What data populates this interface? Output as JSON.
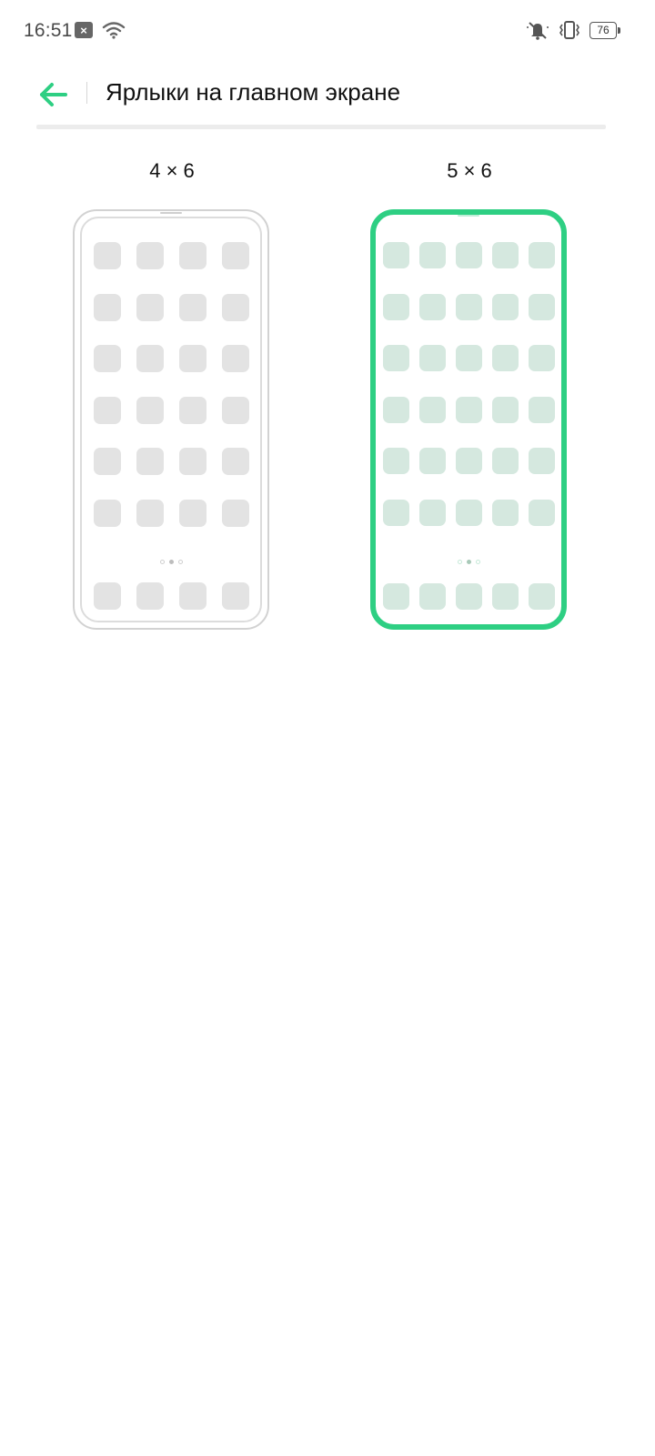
{
  "status_bar": {
    "time": "16:51",
    "notification_icon": "close-box-icon",
    "right_icons": [
      "mute-icon",
      "vibrate-icon"
    ],
    "battery_level": "76"
  },
  "header": {
    "title": "Ярлыки на главном экране",
    "back_icon": "arrow-left-icon"
  },
  "options": [
    {
      "label": "4 × 6",
      "columns": 4,
      "rows": 6,
      "selected": false
    },
    {
      "label": "5 × 6",
      "columns": 5,
      "rows": 6,
      "selected": true
    }
  ],
  "colors": {
    "accent": "#2ecf83",
    "selected_tile": "#d5e8df",
    "unselected_tile": "#e3e3e3"
  }
}
